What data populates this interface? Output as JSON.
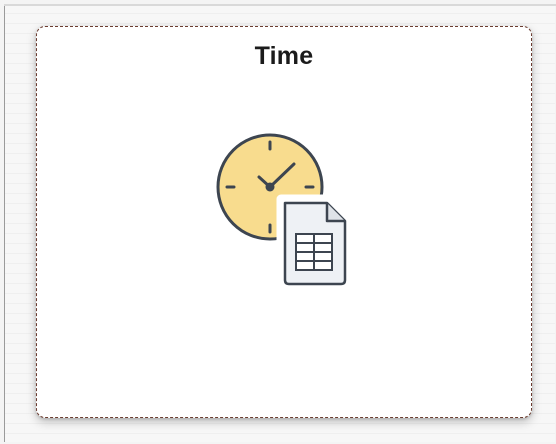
{
  "tile": {
    "title": "Time",
    "icon": "clock-document-icon"
  },
  "colors": {
    "clock_face": "#f8dc8e",
    "outline": "#3d4550",
    "tile_border": "#6b3c30",
    "document": "#eef1f5"
  }
}
